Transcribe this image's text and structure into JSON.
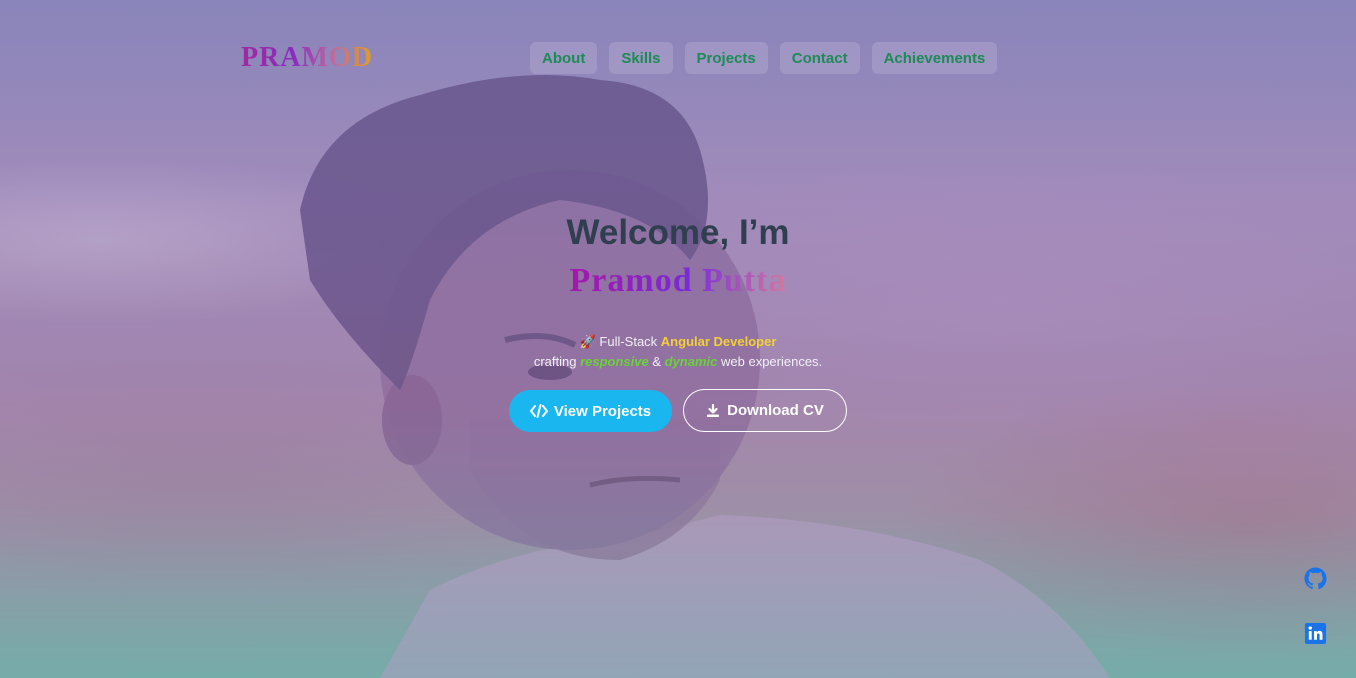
{
  "brand": {
    "logo": "PRAMOD"
  },
  "nav": {
    "items": [
      {
        "label": "About"
      },
      {
        "label": "Skills"
      },
      {
        "label": "Projects"
      },
      {
        "label": "Contact"
      },
      {
        "label": "Achievements"
      }
    ]
  },
  "hero": {
    "greeting": "Welcome, I’m",
    "name": "Pramod Putta",
    "tagline": {
      "emoji": "🚀",
      "prefix": " Full-Stack ",
      "role": "Angular Developer",
      "crafting": "crafting ",
      "word1": "responsive",
      "amp": " & ",
      "word2": "dynamic",
      "suffix": " web experiences."
    },
    "buttons": {
      "view_projects": "View Projects",
      "download_cv": "Download CV"
    }
  },
  "social": {
    "icons": [
      "github-icon",
      "linkedin-icon"
    ]
  },
  "colors": {
    "nav_text": "#1e8a55",
    "primary_button": "#1ab6ef",
    "role_highlight": "#f4cf3a",
    "word_highlight": "#6ad23a",
    "social_icon": "#1a73e8"
  }
}
